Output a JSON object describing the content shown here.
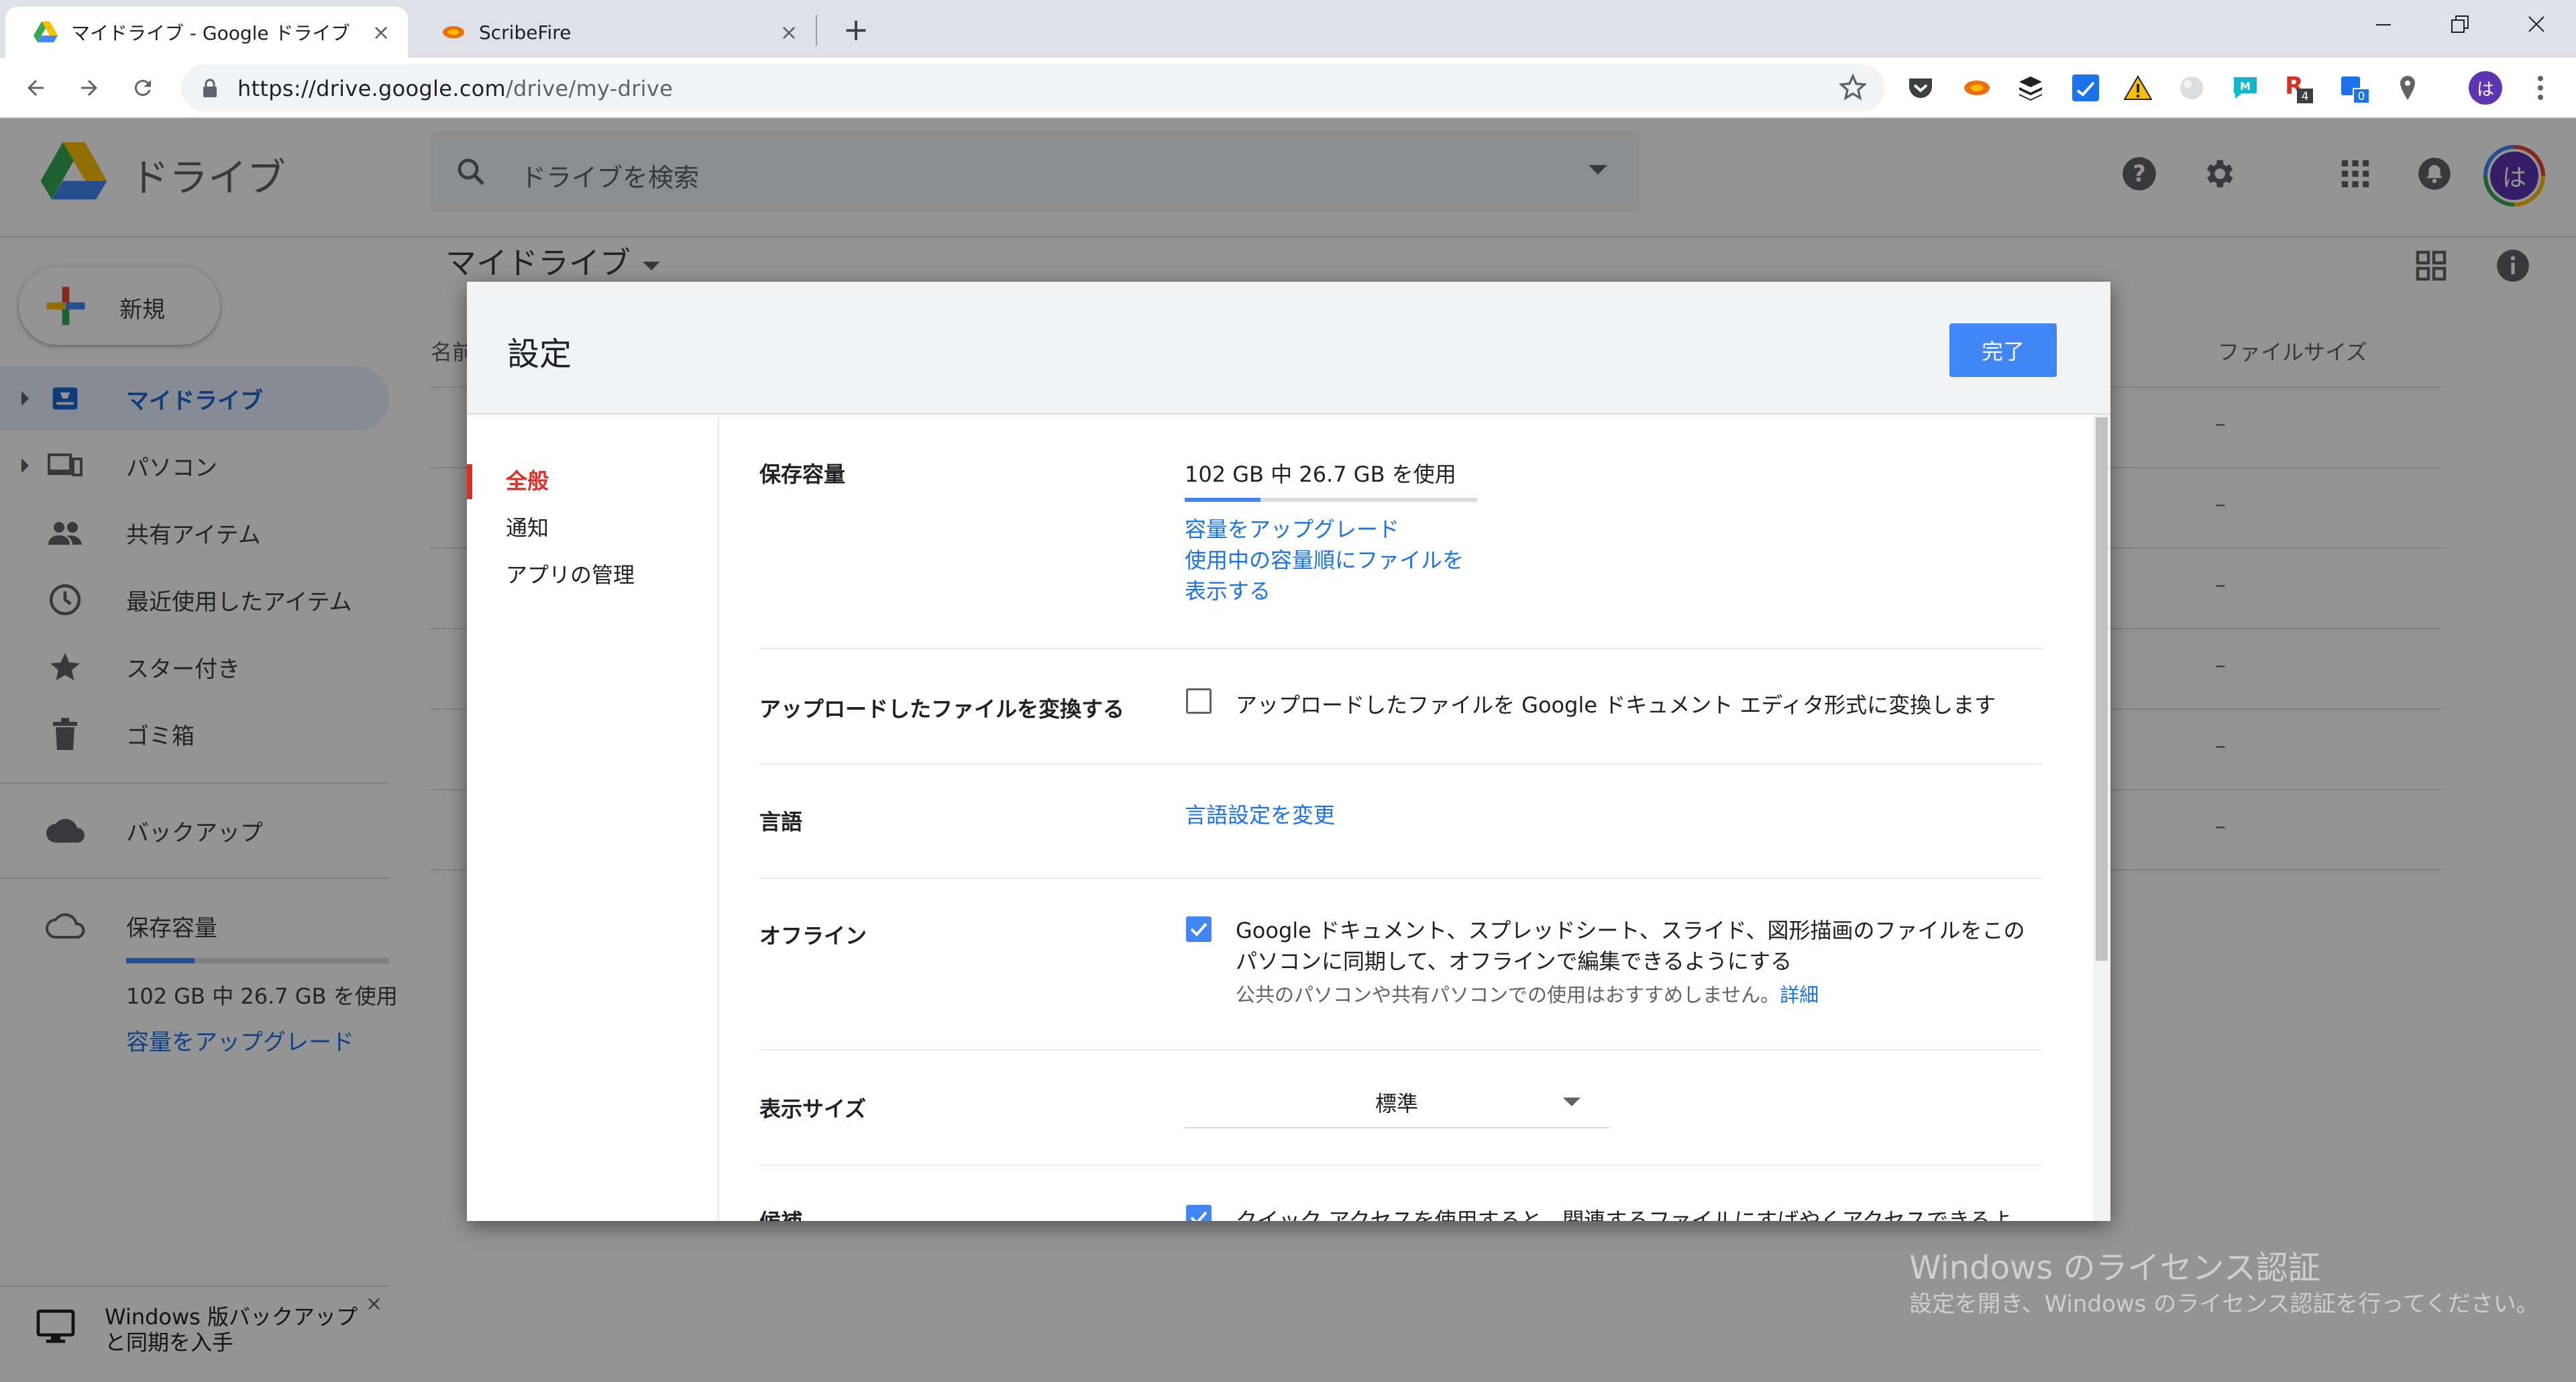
{
  "browser": {
    "tabs": [
      {
        "title": "マイドライブ - Google ドライブ",
        "icon": "google-drive-icon"
      },
      {
        "title": "ScribeFire",
        "icon": "scribefire-icon"
      }
    ],
    "url_host": "https://drive.google.com",
    "url_path": "/drive/my-drive",
    "extension_badges": {
      "r_count": "4",
      "blue_count": "0"
    },
    "profile_letter": "は"
  },
  "drive": {
    "brand": "ドライブ",
    "search_placeholder": "ドライブを検索",
    "folder_title": "マイドライブ",
    "new_button": "新規",
    "avatar_letter": "は",
    "nav": [
      {
        "label": "マイドライブ",
        "icon": "my-drive-icon",
        "selected": true
      },
      {
        "label": "パソコン",
        "icon": "computers-icon"
      },
      {
        "label": "共有アイテム",
        "icon": "people-icon"
      },
      {
        "label": "最近使用したアイテム",
        "icon": "clock-icon"
      },
      {
        "label": "スター付き",
        "icon": "star-icon"
      },
      {
        "label": "ゴミ箱",
        "icon": "trash-icon"
      },
      {
        "label": "バックアップ",
        "icon": "cloud-filled-icon"
      },
      {
        "label": "保存容量",
        "icon": "cloud-outline-icon"
      }
    ],
    "storage_used": 0.26,
    "storage_text": "102 GB 中 26.7 GB を使用",
    "upgrade_link": "容量をアップグレード",
    "columns": {
      "name": "名前",
      "filesize": "ファイルサイズ"
    },
    "row_placeholder": "–",
    "promo": {
      "line1": "Windows 版バックアップ",
      "line2": "と同期を入手",
      "close": "×"
    }
  },
  "windows_watermark": {
    "title": "Windows のライセンス認証",
    "subtitle": "設定を開き、Windows のライセンス認証を行ってください。"
  },
  "settings_dialog": {
    "title": "設定",
    "done_button": "完了",
    "side_nav": [
      {
        "label": "全般",
        "selected": true
      },
      {
        "label": "通知"
      },
      {
        "label": "アプリの管理"
      }
    ],
    "storage": {
      "label": "保存容量",
      "usage": "102 GB 中 26.7 GB を使用",
      "used_fraction": 0.26,
      "upgrade": "容量をアップグレード",
      "view_by_usage_1": "使用中の容量順にファイルを",
      "view_by_usage_2": "表示する"
    },
    "convert": {
      "label": "アップロードしたファイルを変換する",
      "checked": false,
      "text": "アップロードしたファイルを Google ドキュメント エディタ形式に変換します"
    },
    "language": {
      "label": "言語",
      "link": "言語設定を変更"
    },
    "offline": {
      "label": "オフライン",
      "checked": true,
      "text_1": "Google ドキュメント、スプレッドシート、スライド、図形描画のファイルをこの",
      "text_2": "パソコンに同期して、オフラインで編集できるようにする",
      "note": "公共のパソコンや共有パソコンでの使用はおすすめしません。",
      "details_link": "詳細"
    },
    "display_size": {
      "label": "表示サイズ",
      "value": "標準"
    },
    "suggestions": {
      "label": "候補",
      "checked": true,
      "text": "クイック アクセスを使用すると、関連するファイルにすばやくアクセスできるよ"
    }
  }
}
